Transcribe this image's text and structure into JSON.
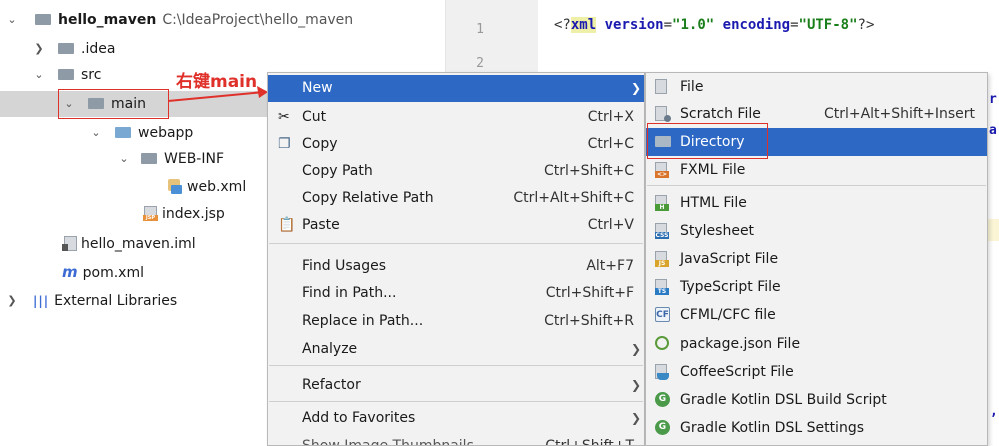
{
  "tree": {
    "project": {
      "name": "hello_maven",
      "path": "C:\\IdeaProject\\hello_maven"
    },
    "items": [
      {
        "label": ".idea"
      },
      {
        "label": "src"
      },
      {
        "label": "main"
      },
      {
        "label": "webapp"
      },
      {
        "label": "WEB-INF"
      },
      {
        "label": "web.xml"
      },
      {
        "label": "index.jsp"
      },
      {
        "label": "hello_maven.iml"
      },
      {
        "label": "pom.xml"
      },
      {
        "label": "External Libraries"
      }
    ],
    "annotation": "右键main"
  },
  "editor": {
    "line_numbers": [
      "1",
      "2"
    ],
    "code_line": {
      "open": "<?",
      "kw": "xml",
      "attr1": "version",
      "val1": "\"1.0\"",
      "attr2": "encoding",
      "val2": "\"UTF-8\"",
      "close": "?>"
    },
    "edge_glyphs": [
      "r",
      "a",
      ","
    ]
  },
  "menu": {
    "items": [
      {
        "label": "New",
        "shortcut": ""
      },
      {
        "label": "Cut",
        "shortcut": "Ctrl+X"
      },
      {
        "label": "Copy",
        "shortcut": "Ctrl+C"
      },
      {
        "label": "Copy Path",
        "shortcut": "Ctrl+Shift+C"
      },
      {
        "label": "Copy Relative Path",
        "shortcut": "Ctrl+Alt+Shift+C"
      },
      {
        "label": "Paste",
        "shortcut": "Ctrl+V"
      },
      {
        "label": "Find Usages",
        "shortcut": "Alt+F7"
      },
      {
        "label": "Find in Path...",
        "shortcut": "Ctrl+Shift+F"
      },
      {
        "label": "Replace in Path...",
        "shortcut": "Ctrl+Shift+R"
      },
      {
        "label": "Analyze",
        "shortcut": ""
      },
      {
        "label": "Refactor",
        "shortcut": ""
      },
      {
        "label": "Add to Favorites",
        "shortcut": ""
      },
      {
        "label": "Show Image Thumbnails",
        "shortcut": "Ctrl+Shift+T"
      }
    ]
  },
  "submenu": {
    "items": [
      {
        "label": "File",
        "shortcut": ""
      },
      {
        "label": "Scratch File",
        "shortcut": "Ctrl+Alt+Shift+Insert"
      },
      {
        "label": "Directory",
        "shortcut": ""
      },
      {
        "label": "FXML File",
        "shortcut": ""
      },
      {
        "label": "HTML File",
        "shortcut": ""
      },
      {
        "label": "Stylesheet",
        "shortcut": ""
      },
      {
        "label": "JavaScript File",
        "shortcut": ""
      },
      {
        "label": "TypeScript File",
        "shortcut": ""
      },
      {
        "label": "CFML/CFC file",
        "shortcut": ""
      },
      {
        "label": "package.json File",
        "shortcut": ""
      },
      {
        "label": "CoffeeScript File",
        "shortcut": ""
      },
      {
        "label": "Gradle Kotlin DSL Build Script",
        "shortcut": ""
      },
      {
        "label": "Gradle Kotlin DSL Settings",
        "shortcut": ""
      }
    ],
    "icon_tags": {
      "html": "H",
      "css": "CSS",
      "js": "JS",
      "ts": "TS",
      "fxml": "<>",
      "cf": "CF",
      "gradle": "G"
    }
  },
  "colors": {
    "selection": "#2d69c4",
    "annotation": "#e0302a",
    "tree_selection": "#d5d5d5"
  }
}
